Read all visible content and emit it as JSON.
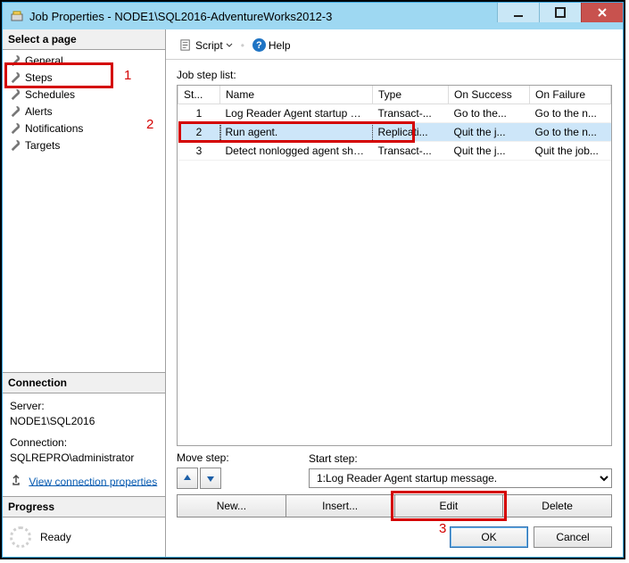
{
  "window": {
    "title": "Job Properties - NODE1\\SQL2016-AdventureWorks2012-3"
  },
  "left": {
    "select_page_header": "Select a page",
    "nav": [
      {
        "label": "General"
      },
      {
        "label": "Steps"
      },
      {
        "label": "Schedules"
      },
      {
        "label": "Alerts"
      },
      {
        "label": "Notifications"
      },
      {
        "label": "Targets"
      }
    ],
    "connection_header": "Connection",
    "server_label": "Server:",
    "server_value": "NODE1\\SQL2016",
    "conn_label": "Connection:",
    "conn_value": "SQLREPRO\\administrator",
    "view_conn_link": "View connection properties",
    "progress_header": "Progress",
    "progress_text": "Ready"
  },
  "toolbar": {
    "script_label": "Script",
    "help_label": "Help"
  },
  "main": {
    "list_label": "Job step list:",
    "cols": {
      "id": "St...",
      "name": "Name",
      "type": "Type",
      "succ": "On Success",
      "fail": "On Failure"
    },
    "rows": [
      {
        "id": "1",
        "name": "Log Reader Agent startup message.",
        "type": "Transact-...",
        "succ": "Go to the...",
        "fail": "Go to the n..."
      },
      {
        "id": "2",
        "name": "Run agent.",
        "type": "Replicati...",
        "succ": "Quit the j...",
        "fail": "Go to the n..."
      },
      {
        "id": "3",
        "name": "Detect nonlogged agent shutdown.",
        "type": "Transact-...",
        "succ": "Quit the j...",
        "fail": "Quit the job..."
      }
    ],
    "move_label": "Move step:",
    "start_label": "Start step:",
    "start_value": "1:Log Reader Agent startup message.",
    "btn_new": "New...",
    "btn_insert": "Insert...",
    "btn_edit": "Edit",
    "btn_delete": "Delete",
    "btn_ok": "OK",
    "btn_cancel": "Cancel"
  },
  "annotations": {
    "one": "1",
    "two": "2",
    "three": "3"
  }
}
